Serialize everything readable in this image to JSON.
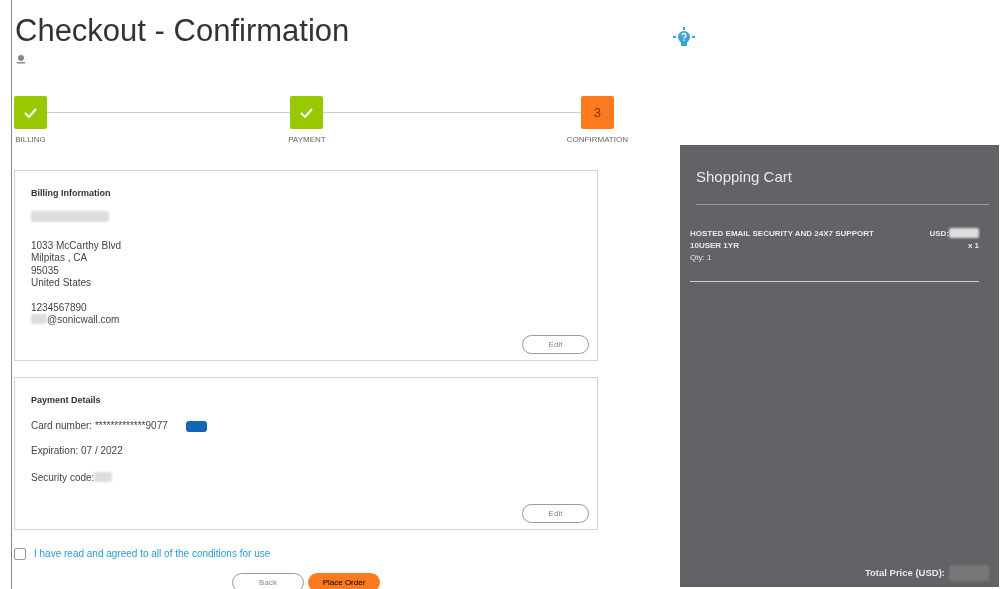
{
  "title": "Checkout - Confirmation",
  "steps": [
    {
      "label": "BILLING",
      "completed": true
    },
    {
      "label": "PAYMENT",
      "completed": true
    },
    {
      "label": "CONFIRMATION",
      "completed": false,
      "number": "3"
    }
  ],
  "billing": {
    "heading": "Billing Information",
    "address": [
      "1033 McCarthy Blvd",
      "Milpitas , CA",
      "95035",
      "United States"
    ],
    "phone": "1234567890",
    "email": "@sonicwall.com",
    "edit": "Edit"
  },
  "payment": {
    "heading": "Payment Details",
    "card_number": "Card number: *************9077",
    "expiration": "Expiration: 07 / 2022",
    "security_code": "Security code:",
    "edit": "Edit"
  },
  "agreement": {
    "label": "I have read and agreed to all of the conditions for use",
    "checked": false
  },
  "buttons": [
    {
      "label": "Back",
      "kind": "secondary"
    },
    {
      "label": "Place Order",
      "kind": "primary"
    }
  ],
  "cart": {
    "title": "Shopping Cart",
    "items": [
      {
        "name": "HOSTED EMAIL SECURITY AND 24X7 SUPPORT 10USER 1YR",
        "price_label": "USD:",
        "multiplier": "x 1",
        "qty": "Qty: 1"
      }
    ],
    "total_label": "Total Price (USD):"
  }
}
